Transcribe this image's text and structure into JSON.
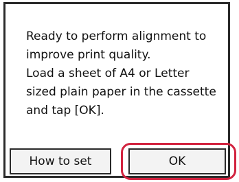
{
  "dialog": {
    "message": "Ready to perform alignment to\nimprove print quality.\nLoad a sheet of A4 or Letter\nsized plain paper in the cassette\nand tap [OK]."
  },
  "buttons": {
    "how_to_set": "How to set",
    "ok": "OK"
  },
  "colors": {
    "highlight": "#d2233f",
    "frame": "#2a2a2a",
    "button_fill": "#f3f3f3"
  }
}
